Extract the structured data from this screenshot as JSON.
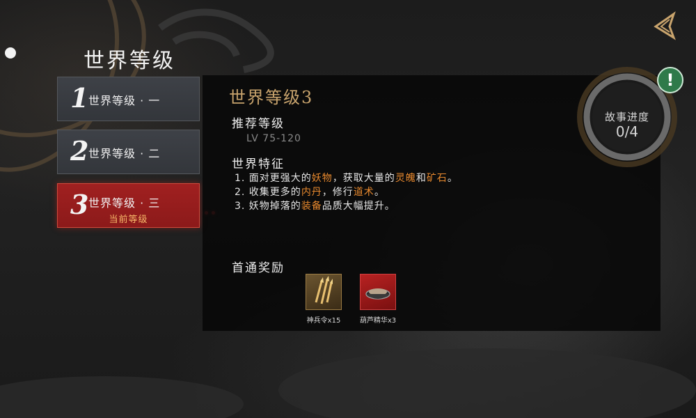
{
  "header": {
    "title": "世界等级"
  },
  "levels": [
    {
      "num": "1",
      "label": "世界等级 · 一"
    },
    {
      "num": "2",
      "label": "世界等级 · 二"
    },
    {
      "num": "3",
      "label": "世界等级 · 三",
      "sub": "当前等级"
    }
  ],
  "panel": {
    "title": "世界等级3",
    "recommend_title": "推荐等级",
    "recommend_value": "LV 75-120",
    "features_title": "世界特征",
    "features": [
      {
        "a": "1. 面对更强大的",
        "b": "妖物",
        "c": "，获取大量的",
        "d": "灵魄",
        "e": "和",
        "f": "矿石",
        "g": "。"
      },
      {
        "a": "2. 收集更多的",
        "b": "内丹",
        "c": "，修行",
        "d": "道术",
        "e": "。"
      },
      {
        "a": "3. 妖物掉落的",
        "b": "装备",
        "c": "品质大幅提升。"
      }
    ],
    "reward_title": "首通奖励",
    "rewards": [
      {
        "name": "神兵令x15",
        "icon": "sword-token-icon"
      },
      {
        "name": "葫芦精华x3",
        "icon": "gourd-essence-icon"
      }
    ]
  },
  "progress": {
    "label": "故事进度",
    "value": "0/4",
    "fraction": 0
  },
  "colors": {
    "accent_gold": "#c9a46d",
    "highlight_orange": "#e8892e",
    "active_red": "#a02020",
    "alert_green": "#2f7a4a"
  }
}
